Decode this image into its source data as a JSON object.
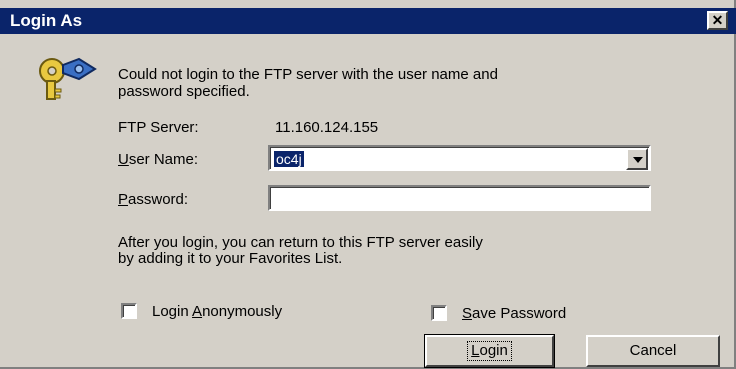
{
  "dialog": {
    "title": "Login As",
    "close_label": "✕",
    "message_line1": "Could not login to the FTP server with the user name and",
    "message_line2": "password specified.",
    "ftp_server_label": "FTP Server:",
    "ftp_server_value": "11.160.124.155",
    "user_name_label_prefix": "",
    "user_name_label_accel": "U",
    "user_name_label_rest": "ser Name:",
    "user_name_value": "oc4j",
    "password_label_accel": "P",
    "password_label_rest": "assword:",
    "password_value": "",
    "info_line1": "After you login, you can return to this FTP server easily",
    "info_line2": "by adding it to your Favorites List.",
    "login_anon_label_pre": "Login ",
    "login_anon_label_accel": "A",
    "login_anon_label_rest": "nonymously",
    "save_password_accel": "S",
    "save_password_rest": "ave Password",
    "login_button_accel": "L",
    "login_button_rest": "ogin",
    "cancel_button": "Cancel"
  },
  "icon": {
    "name": "keys-icon"
  },
  "colors": {
    "titlebar": "#0a246a",
    "face": "#d4d0c8"
  }
}
